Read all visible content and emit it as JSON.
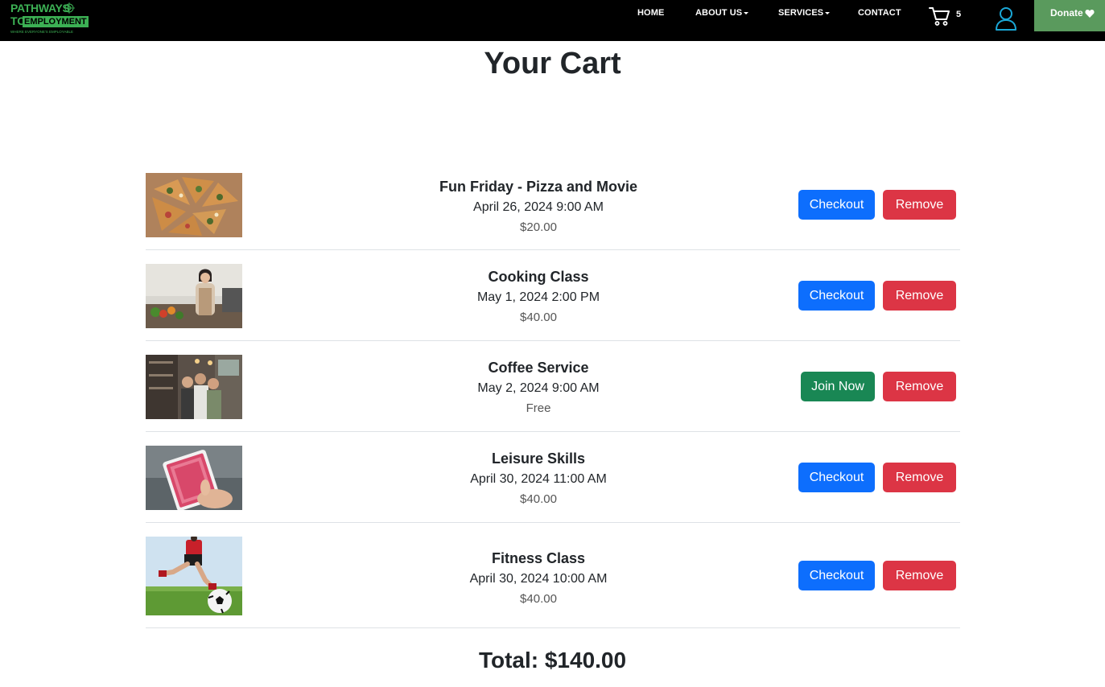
{
  "logo": {
    "line1": "PATHWAYS",
    "line2": "TO",
    "line2b": "EMPLOYMENT",
    "tagline": "WHERE EVERYONE'S EMPLOYABLE"
  },
  "nav": {
    "home": "HOME",
    "about": "ABOUT US",
    "services": "SERVICES",
    "contact": "CONTACT",
    "cart_count": "5",
    "donate": "Donate"
  },
  "page": {
    "title": "Your Cart",
    "total": "Total: $140.00"
  },
  "items": [
    {
      "title": "Fun Friday - Pizza and Movie",
      "date": "April 26, 2024 9:00 AM",
      "price": "$20.00",
      "action": "Checkout",
      "remove": "Remove",
      "image": "pizza-photo"
    },
    {
      "title": "Cooking Class",
      "date": "May 1, 2024 2:00 PM",
      "price": "$40.00",
      "action": "Checkout",
      "remove": "Remove",
      "image": "chef-photo"
    },
    {
      "title": "Coffee Service",
      "date": "May 2, 2024 9:00 AM",
      "price": "Free",
      "action": "Join Now",
      "remove": "Remove",
      "image": "cafe-group-photo"
    },
    {
      "title": "Leisure Skills",
      "date": "April 30, 2024 11:00 AM",
      "price": "$40.00",
      "action": "Checkout",
      "remove": "Remove",
      "image": "playing-cards-photo"
    },
    {
      "title": "Fitness Class",
      "date": "April 30, 2024 10:00 AM",
      "price": "$40.00",
      "action": "Checkout",
      "remove": "Remove",
      "image": "soccer-photo"
    }
  ],
  "colors": {
    "checkout": "#0d6efd",
    "join": "#198754",
    "remove": "#dc3545",
    "brand_green": "#3cb054",
    "donate_bg": "#5a9a5d",
    "user_icon": "#1aa7d6"
  }
}
